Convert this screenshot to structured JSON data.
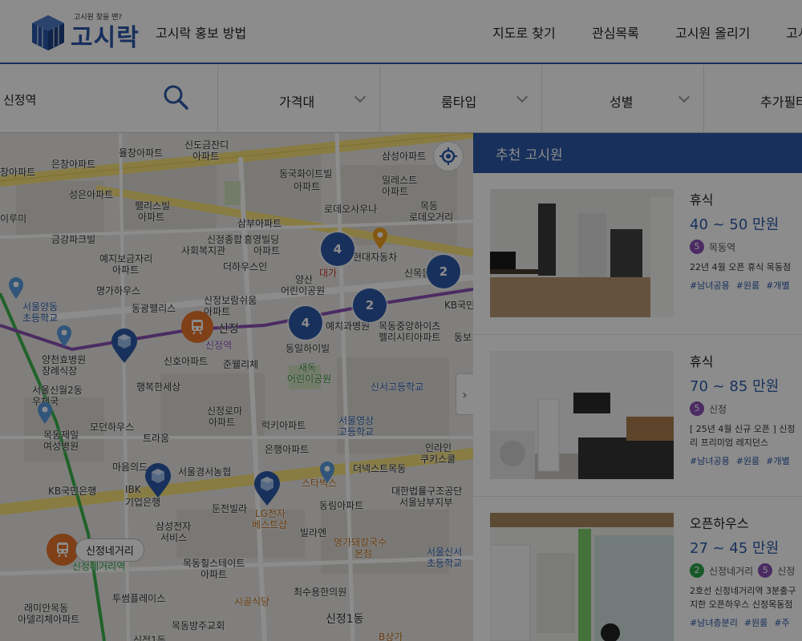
{
  "header": {
    "logo_tag": "고시원 찾을 땐?",
    "logo_word": "고시락",
    "promo_link": "고시락 홍보 방법",
    "nav": [
      "지도로 찾기",
      "관심목록",
      "고시원 올리기",
      "고시"
    ]
  },
  "filters": {
    "search_value": "신정역",
    "price": "가격대",
    "room_type": "룸타입",
    "gender": "성별",
    "more": "추가필터"
  },
  "map": {
    "clusters": [
      "4",
      "2",
      "2",
      "4"
    ],
    "stations": [
      {
        "name": "신정",
        "sub": "신정역"
      },
      {
        "name": "신정네거리",
        "sub": "신정네거리역"
      }
    ],
    "labels": [
      "신도금잔디",
      "아파트",
      "율창아파트",
      "은창아파트",
      "삼성아파트",
      "창아파트",
      "동국화이트빌",
      "아파트",
      "밀레스트",
      "아파트",
      "성은아파트",
      "팰리스빌",
      "아파트",
      "로데오사우나",
      "목동",
      "로데오거리",
      "이루미",
      "삼부아파트",
      "금강파크빌",
      "신정종합",
      "사회복지관",
      "흥영빌딩",
      "아파트",
      "현대자동차",
      "예지보금자리",
      "아파트",
      "더하우스인",
      "신목동역",
      "명가하우스",
      "양산",
      "어린이공원",
      "대가",
      "서울양동",
      "초등학교",
      "동광팰리스",
      "신정보람쉬움",
      "아파트",
      "KB국민",
      "예치과병원",
      "목동중앙하이츠",
      "펠리시티아파트",
      "동보",
      "양천효병원",
      "장례식장",
      "신호아파트",
      "동일하이빌",
      "준웰리체",
      "새독",
      "어린이공원",
      "신서고등학교",
      "서울신월2동",
      "우체국",
      "행복한세상",
      "신정로마",
      "아파트",
      "목동제일",
      "여성병원",
      "모던하우스",
      "럭키아파트",
      "서울영상",
      "고등학교",
      "인라인",
      "쿠키스쿨",
      "트라움",
      "은행아파트",
      "마음의드",
      "서울경서농협",
      "더넥스트목동",
      "KB국민은행",
      "IBK",
      "기업은행",
      "스타벅스",
      "대한법률구조공단",
      "서울남부지부",
      "둔전빌라",
      "LG전자",
      "베스트샵",
      "동림아파트",
      "삼성전자",
      "서비스",
      "빌라엔",
      "명가돼칼국수",
      "본점",
      "서울신서",
      "초등학교",
      "목동힐스테이트",
      "아파트",
      "래미안목동",
      "아델리체아파트",
      "투썸플레이스",
      "시골식당",
      "최수용한의원",
      "목동방주교회",
      "신정1동",
      "B상가",
      "신정1동"
    ]
  },
  "panel": {
    "title": "추천 고시원",
    "cards": [
      {
        "type": "휴식",
        "price": "40 ~ 50 만원",
        "stations": [
          {
            "line": "5",
            "name": "목동역"
          }
        ],
        "desc": [
          "22년 4월 오픈 휴식 목동점"
        ],
        "tags": [
          "#남녀공용",
          "#원룸",
          "#개별"
        ]
      },
      {
        "type": "휴식",
        "price": "70 ~ 85 만원",
        "stations": [
          {
            "line": "5",
            "name": "신정"
          }
        ],
        "desc": [
          "[ 25년 4월 신규 오픈 ] 신정",
          "리 프리미엄 레지던스"
        ],
        "tags": [
          "#남녀공용",
          "#원룸",
          "#개별"
        ]
      },
      {
        "type": "오픈하우스",
        "price": "27 ~ 45 만원",
        "stations": [
          {
            "line": "2",
            "name": "신정네거리"
          },
          {
            "line": "5",
            "name": "신정"
          }
        ],
        "desc": [
          "2호선 신정네거리역 3분출구",
          "지한 오픈하우스 신정목동점"
        ],
        "tags": [
          "#남녀층분리",
          "#원룸",
          "#주"
        ]
      }
    ]
  },
  "colors": {
    "brand": "#2c5aa8",
    "station": "#e8732a",
    "line5": "#8a4fb5",
    "line2": "#2aa34a"
  }
}
